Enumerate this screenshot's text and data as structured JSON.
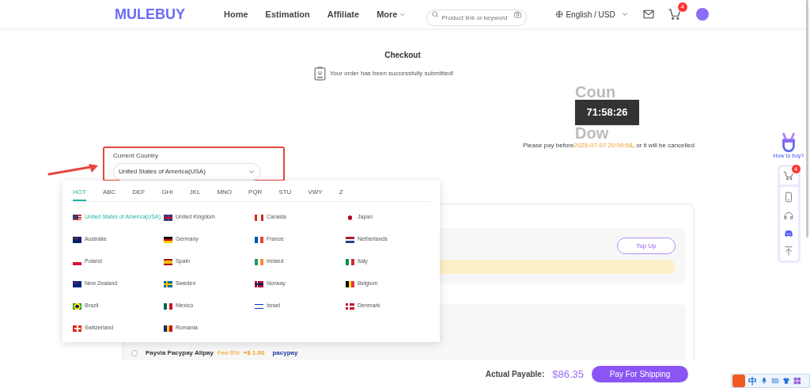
{
  "header": {
    "logo": "MULEBUY",
    "nav": [
      {
        "label": "Home",
        "has_menu": false
      },
      {
        "label": "Estimation",
        "has_menu": false
      },
      {
        "label": "Affiliate",
        "has_menu": false
      },
      {
        "label": "More",
        "has_menu": true
      }
    ],
    "search": {
      "placeholder": "Product link or keyword"
    },
    "language": "English / USD",
    "cart_badge": "4"
  },
  "checkout": {
    "title": "Checkout",
    "message": "Your order has been successfully submitted!",
    "countdown": {
      "ghost_top": "Coun",
      "ghost_bottom": "Dow",
      "time": "71:58:26"
    },
    "deadline": {
      "prefix": "Please pay before",
      "date": "2025-07-07 20:00:58",
      "suffix": ", or it will be cancelled"
    }
  },
  "country_field": {
    "label": "Current Country",
    "value": "United States of America(USA)"
  },
  "dropdown": {
    "tabs": [
      {
        "label": "HOT",
        "selected": true
      },
      {
        "label": "ABC",
        "selected": false
      },
      {
        "label": "DEF",
        "selected": false
      },
      {
        "label": "GHI",
        "selected": false
      },
      {
        "label": "JKL",
        "selected": false
      },
      {
        "label": "MNO",
        "selected": false
      },
      {
        "label": "PQR",
        "selected": false
      },
      {
        "label": "STU",
        "selected": false
      },
      {
        "label": "VWY",
        "selected": false
      },
      {
        "label": "Z",
        "selected": false
      }
    ],
    "countries": [
      {
        "name": "United States of America(USA)",
        "selected": true
      },
      {
        "name": "United Kingdom",
        "selected": false
      },
      {
        "name": "Canada",
        "selected": false
      },
      {
        "name": "Japan",
        "selected": false
      },
      {
        "name": "Australia",
        "selected": false
      },
      {
        "name": "Germany",
        "selected": false
      },
      {
        "name": "France",
        "selected": false
      },
      {
        "name": "Netherlands",
        "selected": false
      },
      {
        "name": "Poland",
        "selected": false
      },
      {
        "name": "Spain",
        "selected": false
      },
      {
        "name": "Ireland",
        "selected": false
      },
      {
        "name": "Italy",
        "selected": false
      },
      {
        "name": "New Zealand",
        "selected": false
      },
      {
        "name": "Sweden",
        "selected": false
      },
      {
        "name": "Norway",
        "selected": false
      },
      {
        "name": "Belgium",
        "selected": false
      },
      {
        "name": "Brazil",
        "selected": false
      },
      {
        "name": "Mexico",
        "selected": false
      },
      {
        "name": "Israel",
        "selected": false
      },
      {
        "name": "Denmark",
        "selected": false
      },
      {
        "name": "Switzerland",
        "selected": false
      },
      {
        "name": "Romania",
        "selected": false
      }
    ]
  },
  "balance": {
    "button": "Top Up"
  },
  "payment": {
    "method": "Payvia Pacypay Alipay",
    "fee": "Fee:6%",
    "extra": "+$ 1.00",
    "brand": "pacypay",
    "selected": false
  },
  "footer": {
    "label": "Actual Payable:",
    "amount": "$86.35",
    "button": "Pay For Shipping"
  },
  "side": {
    "help": "How to buy?",
    "cart_badge": "4"
  },
  "ime": {
    "mode": "中"
  }
}
